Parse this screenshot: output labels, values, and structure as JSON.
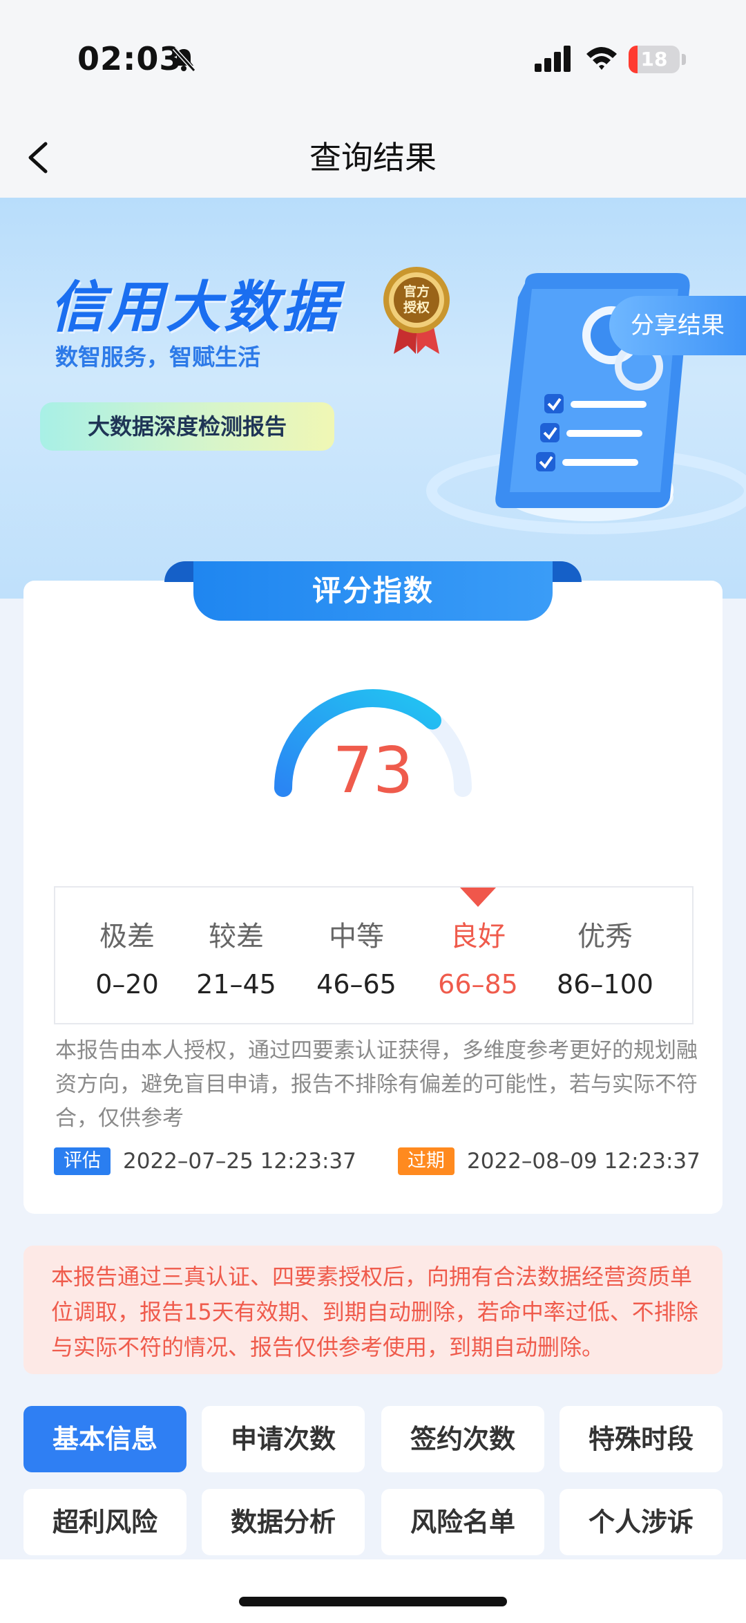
{
  "status_bar": {
    "time": "02:03",
    "battery": "18",
    "battery_level": 0.18
  },
  "nav": {
    "title": "查询结果"
  },
  "banner": {
    "title": "信用大数据",
    "subtitle": "数智服务，智赋生活",
    "medal_text": "官方授权",
    "report_label": "大数据深度检测报告",
    "share_label": "分享结果"
  },
  "score": {
    "tab_label": "评分指数",
    "value": "73",
    "value_number": 73,
    "max": 100,
    "ranges": [
      {
        "label": "极差",
        "range": "0–20"
      },
      {
        "label": "较差",
        "range": "21–45"
      },
      {
        "label": "中等",
        "range": "46–65"
      },
      {
        "label": "良好",
        "range": "66–85"
      },
      {
        "label": "优秀",
        "range": "86–100"
      }
    ],
    "active_range_index": 3,
    "disclaimer": "本报告由本人授权，通过四要素认证获得，多维度参考更好的规划融资方向，避免盲目申请，报告不排除有偏差的可能性，若与实际不符合，仅供参考",
    "eval_tag": "评估",
    "eval_date": "2022–07–25 12:23:37",
    "expire_tag": "过期",
    "expire_date": "2022–08–09 12:23:37"
  },
  "notice": "本报告通过三真认证、四要素授权后，向拥有合法数据经营资质单位调取，报告15天有效期、到期自动删除，若命中率过低、不排除与实际不符的情况、报告仅供参考使用，到期自动删除。",
  "tabs": [
    "基本信息",
    "申请次数",
    "签约次数",
    "特殊时段",
    "超利风险",
    "数据分析",
    "风险名单",
    "个人涉诉"
  ],
  "active_tab_index": 0,
  "colors": {
    "accent": "#2f7ff3",
    "score_red": "#ef5b4c",
    "warning_bg": "#fde9e6",
    "orange_tag": "#ff8a1f"
  }
}
